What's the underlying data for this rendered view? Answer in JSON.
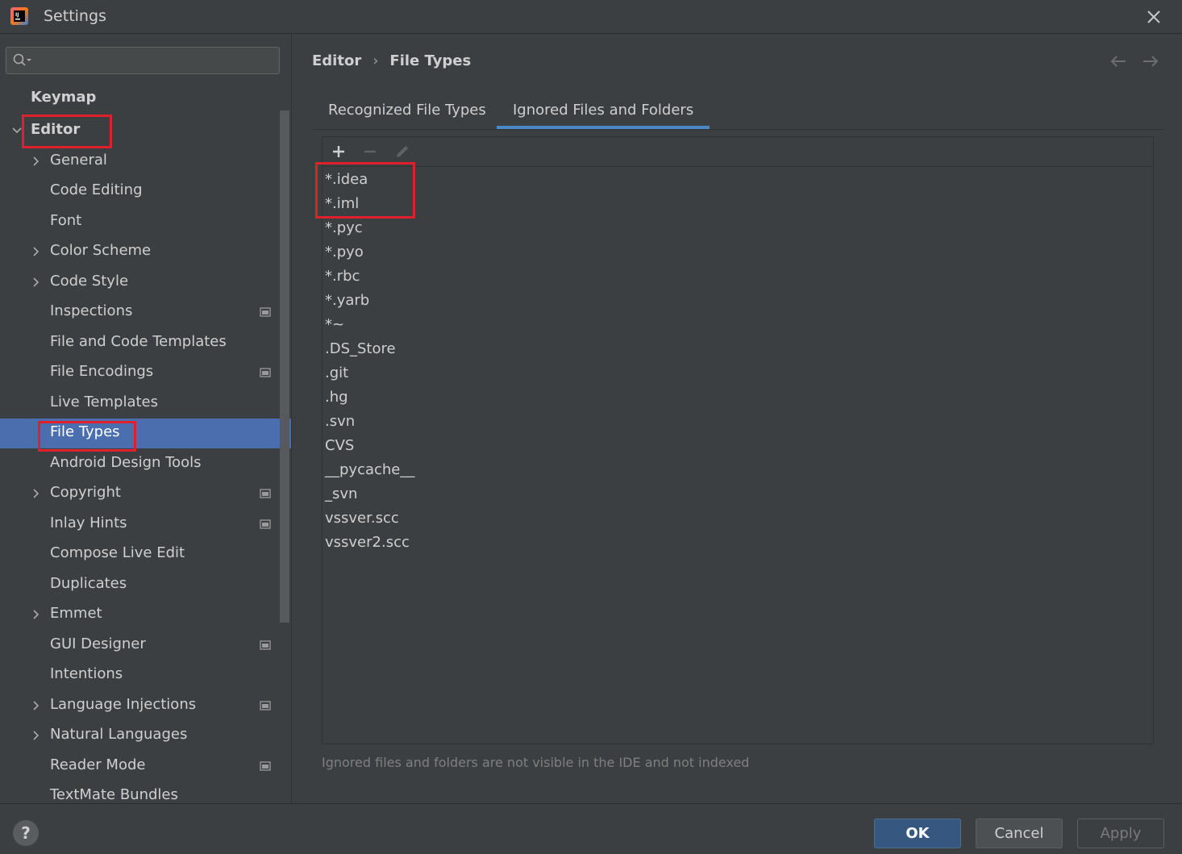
{
  "window": {
    "title": "Settings"
  },
  "search": {
    "placeholder": ""
  },
  "sidebar": {
    "items": [
      {
        "label": "Keymap"
      },
      {
        "label": "Editor"
      },
      {
        "label": "General"
      },
      {
        "label": "Code Editing"
      },
      {
        "label": "Font"
      },
      {
        "label": "Color Scheme"
      },
      {
        "label": "Code Style"
      },
      {
        "label": "Inspections"
      },
      {
        "label": "File and Code Templates"
      },
      {
        "label": "File Encodings"
      },
      {
        "label": "Live Templates"
      },
      {
        "label": "File Types"
      },
      {
        "label": "Android Design Tools"
      },
      {
        "label": "Copyright"
      },
      {
        "label": "Inlay Hints"
      },
      {
        "label": "Compose Live Edit"
      },
      {
        "label": "Duplicates"
      },
      {
        "label": "Emmet"
      },
      {
        "label": "GUI Designer"
      },
      {
        "label": "Intentions"
      },
      {
        "label": "Language Injections"
      },
      {
        "label": "Natural Languages"
      },
      {
        "label": "Reader Mode"
      },
      {
        "label": "TextMate Bundles"
      }
    ]
  },
  "breadcrumb": {
    "parent": "Editor",
    "current": "File Types",
    "separator": "›"
  },
  "tabs": [
    {
      "label": "Recognized File Types"
    },
    {
      "label": "Ignored Files and Folders"
    }
  ],
  "patterns": [
    "*.idea",
    "*.iml",
    "*.pyc",
    "*.pyo",
    "*.rbc",
    "*.yarb",
    "*~",
    ".DS_Store",
    ".git",
    ".hg",
    ".svn",
    "CVS",
    "__pycache__",
    "_svn",
    "vssver.scc",
    "vssver2.scc"
  ],
  "hint": "Ignored files and folders are not visible in the IDE and not indexed",
  "footer": {
    "help": "?",
    "ok": "OK",
    "cancel": "Cancel",
    "apply": "Apply"
  },
  "colors": {
    "selection": "#4b6eaf",
    "highlight": "#e0202a",
    "active_tab": "#4a88c7",
    "ok_button": "#365880"
  }
}
